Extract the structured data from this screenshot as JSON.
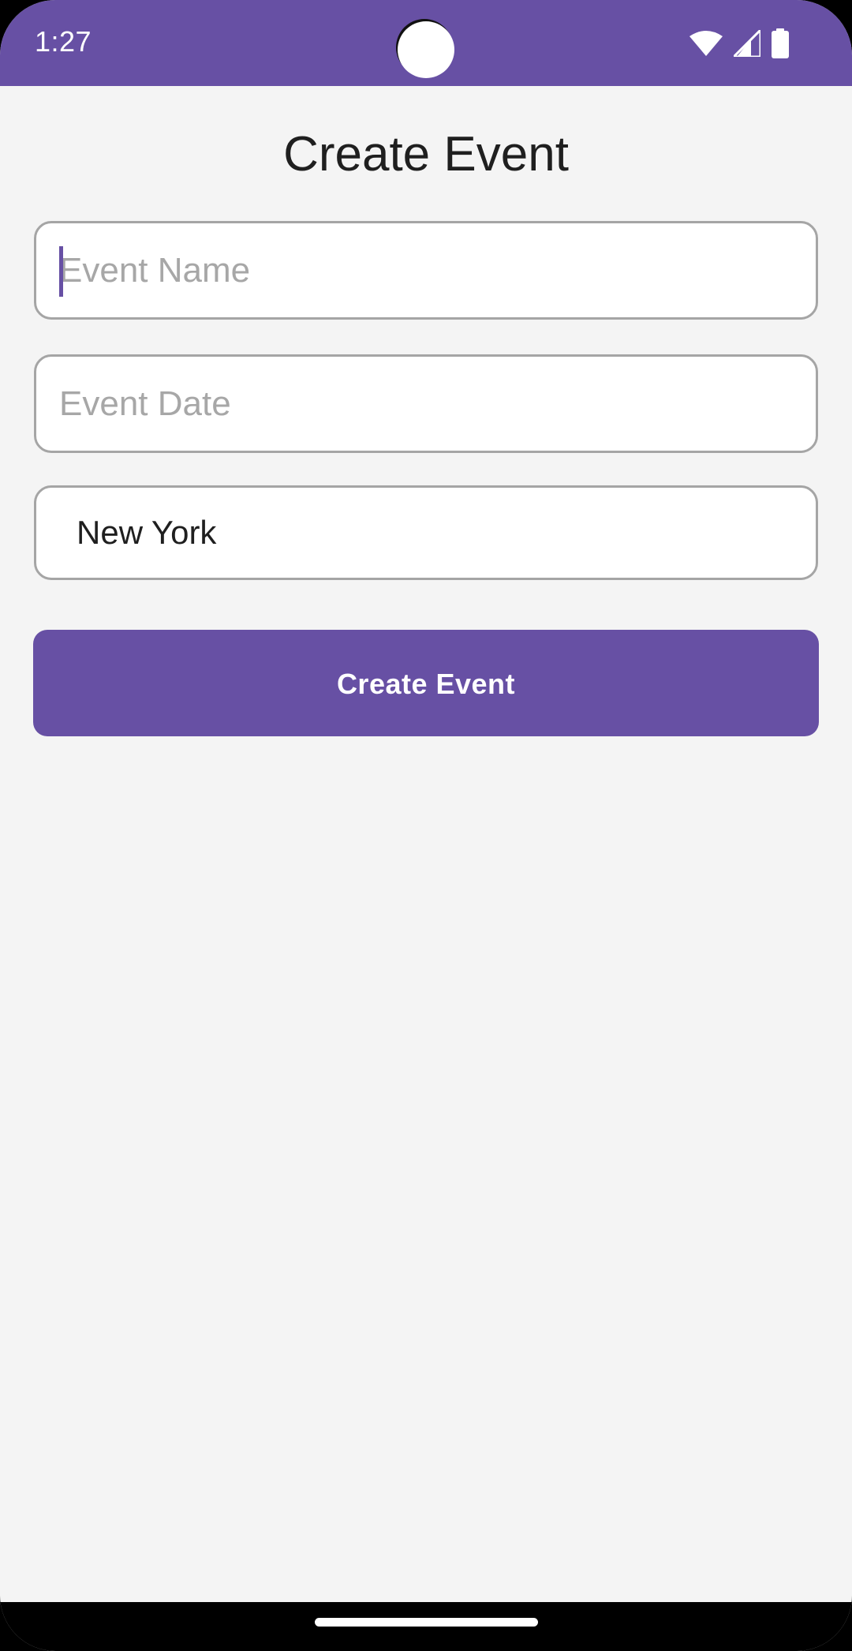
{
  "colors": {
    "accent": "#6750a4",
    "background": "#f4f4f4",
    "field_border": "#a5a5a5",
    "placeholder": "#a7a7a7",
    "text": "#1f1f1f"
  },
  "status_bar": {
    "time": "1:27",
    "icons": [
      "wifi-icon",
      "cellular-signal-icon",
      "battery-icon"
    ]
  },
  "page": {
    "title": "Create Event"
  },
  "form": {
    "event_name": {
      "placeholder": "Event Name",
      "value": ""
    },
    "event_date": {
      "placeholder": "Event Date",
      "value": ""
    },
    "location": {
      "value": "New York"
    },
    "submit_label": "Create Event"
  }
}
